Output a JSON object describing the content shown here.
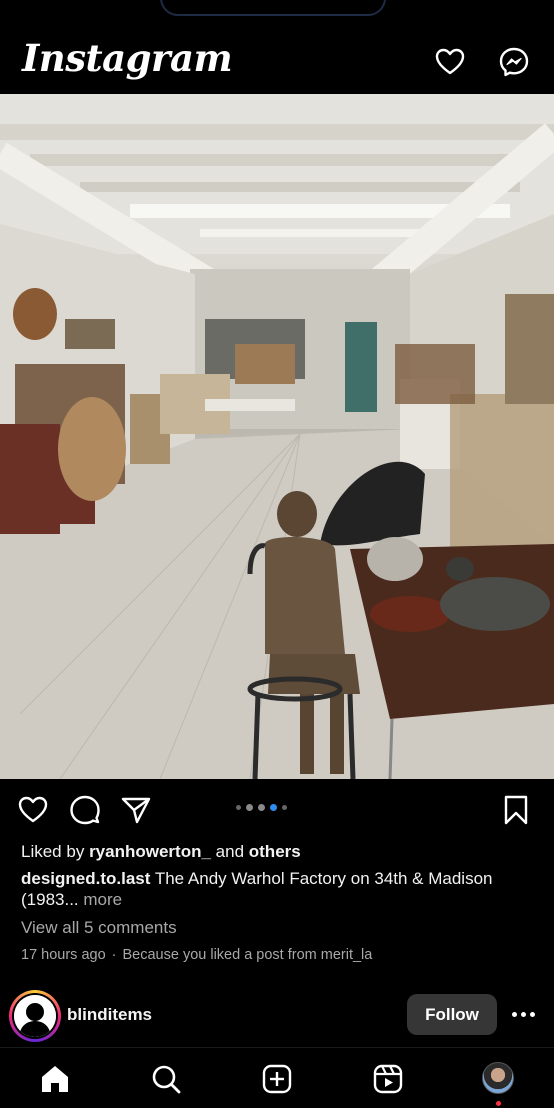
{
  "app": {
    "name": "Instagram"
  },
  "header": {
    "icons": [
      "heart-icon",
      "messenger-icon"
    ]
  },
  "post": {
    "liked_by_prefix": "Liked by",
    "liked_by_user": "ryanhowerton_",
    "liked_by_and": "and",
    "liked_by_others": "others",
    "username": "designed.to.last",
    "caption": "The Andy Warhol Factory on 34th & Madison (1983...",
    "more": "more",
    "comments_link": "View all 5 comments",
    "time": "17 hours ago",
    "separator": "·",
    "suggestion": "Because you liked a post from merit_la",
    "carousel": {
      "count": 5,
      "active_index": 3
    }
  },
  "next_post": {
    "username": "blinditems",
    "follow_label": "Follow"
  },
  "nav": {
    "items": [
      "home-icon",
      "search-icon",
      "create-icon",
      "reels-icon",
      "profile-avatar"
    ]
  },
  "colors": {
    "accent": "#2f8cf3",
    "notification": "#ff3040",
    "follow_bg": "#363636"
  }
}
